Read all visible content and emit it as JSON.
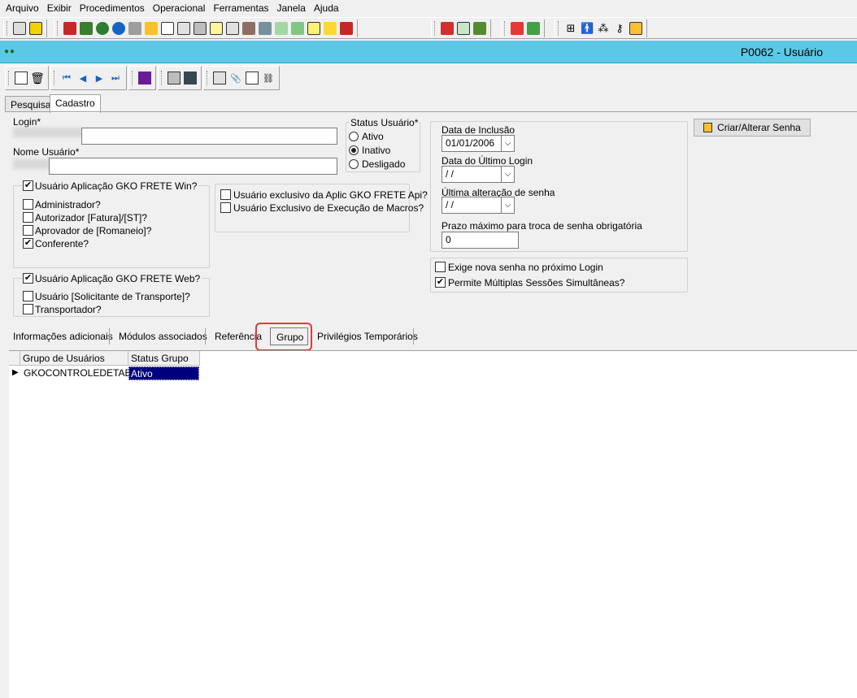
{
  "menu": [
    "Arquivo",
    "Exibir",
    "Procedimentos",
    "Operacional",
    "Ferramentas",
    "Janela",
    "Ajuda"
  ],
  "window_title": "P0062 - Usuário",
  "tabs_top": [
    "Pesquisa",
    "Cadastro"
  ],
  "form": {
    "login_label": "Login*",
    "nome_label": "Nome Usuário*",
    "status_label": "Status Usuário*",
    "status_options": [
      "Ativo",
      "Inativo",
      "Desligado"
    ],
    "status_selected": "Inativo",
    "win_app": "Usuário Aplicação GKO FRETE Win?",
    "win_options": [
      {
        "label": "Administrador?",
        "checked": false
      },
      {
        "label": "Autorizador [Fatura]/[ST]?",
        "checked": false
      },
      {
        "label": "Aprovador de [Romaneio]?",
        "checked": false
      },
      {
        "label": "Conferente?",
        "checked": true
      }
    ],
    "web_app": "Usuário Aplicação GKO FRETE Web?",
    "web_options": [
      {
        "label": "Usuário [Solicitante de Transporte]?",
        "checked": false
      },
      {
        "label": "Transportador?",
        "checked": false
      }
    ],
    "api_exclusive": "Usuário exclusivo da Aplic GKO FRETE Api?",
    "macro_exclusive": "Usuário Exclusivo de Execução de Macros?",
    "data_inclusao_label": "Data de Inclusão",
    "data_inclusao_value": "01/01/2006",
    "data_ultimo_login_label": "Data do Último Login",
    "data_ultimo_login_value": " / /",
    "ultima_alteracao_label": "Última alteração de senha",
    "ultima_alteracao_value": " / /",
    "prazo_label": "Prazo máximo para troca de senha obrigatória",
    "prazo_value": "0",
    "exige_nova_senha": "Exige nova senha no próximo Login",
    "permite_multiplas": "Permite Múltiplas Sessões Simultâneas?",
    "criar_senha_button": "Criar/Alterar Senha"
  },
  "subtabs": [
    "Informações adicionais",
    "Módulos associados",
    "Referência",
    "Grupo",
    "Privilégios Temporários"
  ],
  "grid": {
    "headers": [
      "Grupo de Usuários",
      "Status Grupo"
    ],
    "rows": [
      [
        "GKOCONTROLEDETABELAS",
        "Ativo"
      ]
    ]
  }
}
